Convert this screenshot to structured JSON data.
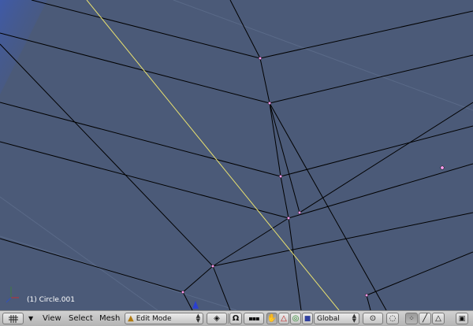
{
  "viewport": {
    "object_label": "(1) Circle.001",
    "background_color": "#4b5a78",
    "edge_color": "#000000",
    "selected_edge_color": "#e8e070",
    "vertex_color": "#ff9ef0"
  },
  "header": {
    "menus": {
      "view": "View",
      "select": "Select",
      "mesh": "Mesh"
    },
    "mode_select": {
      "value": "Edit Mode"
    },
    "orientation_select": {
      "value": "Global"
    }
  },
  "icons": [
    "viewport-type-icon",
    "menu-collapse-arrow-icon",
    "edit-mode-icon",
    "draw-type-icon",
    "snap-icon",
    "layers-icon",
    "hand-manipulator-icon",
    "translate-manipulator-icon",
    "rotate-manipulator-icon",
    "scale-manipulator-icon",
    "pivot-icon",
    "proportional-edit-icon",
    "vertex-select-icon",
    "edge-select-icon",
    "face-select-icon",
    "render-icon"
  ]
}
